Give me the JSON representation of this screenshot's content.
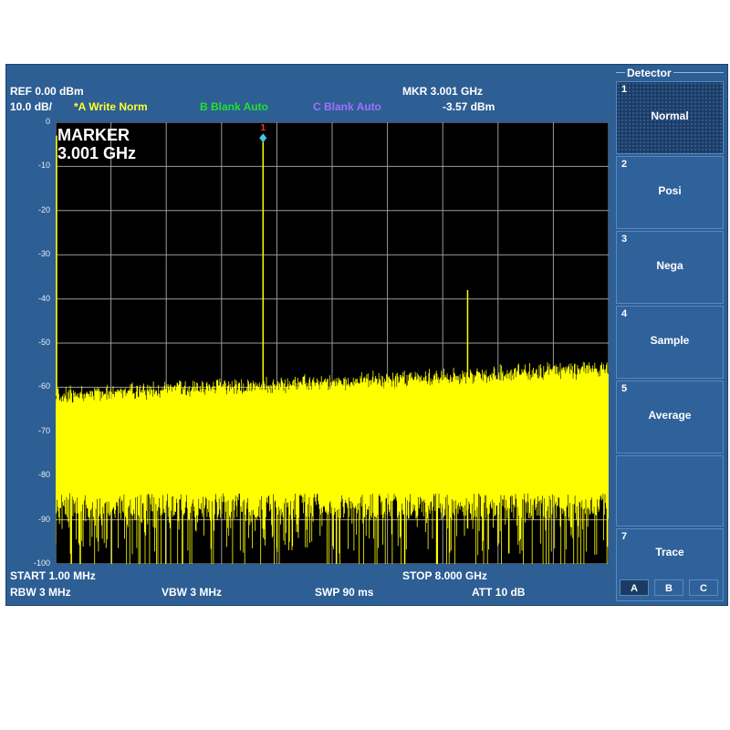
{
  "header": {
    "ref": "REF  0.00 dBm",
    "scale": "10.0 dB/",
    "trace_a": "*A Write Norm",
    "trace_b": "B Blank Auto",
    "trace_c": "C Blank Auto",
    "mkr_freq": "MKR  3.001  GHz",
    "mkr_level": "-3.57 dBm"
  },
  "marker": {
    "title": "MARKER",
    "freq": "3.001 GHz",
    "number": "1"
  },
  "y_labels": [
    "0",
    "-10",
    "-20",
    "-30",
    "-40",
    "-50",
    "-60",
    "-70",
    "-80",
    "-90",
    "-100"
  ],
  "footer": {
    "start": "START   1.00 MHz",
    "stop": "STOP 8.000 GHz",
    "rbw": "RBW  3 MHz",
    "vbw": "VBW  3 MHz",
    "swp": "SWP  90 ms",
    "att": "ATT  10 dB"
  },
  "detector": {
    "title": "Detector",
    "keys": [
      {
        "num": "1",
        "label": "Normal"
      },
      {
        "num": "2",
        "label": "Posi"
      },
      {
        "num": "3",
        "label": "Nega"
      },
      {
        "num": "4",
        "label": "Sample"
      },
      {
        "num": "5",
        "label": "Average"
      },
      {
        "num": "",
        "label": ""
      },
      {
        "num": "7",
        "label": "Trace"
      }
    ],
    "trace_buttons": [
      "A",
      "B",
      "C"
    ]
  },
  "spectrum": {
    "start_ghz": 0.001,
    "stop_ghz": 8.0,
    "ref_dbm": 0,
    "bottom_dbm": -100,
    "peaks": [
      {
        "freq_ghz": 3.001,
        "dbm": -3.57
      },
      {
        "freq_ghz": 5.96,
        "dbm": -38
      }
    ],
    "noise_top_dbm": [
      -62,
      -56
    ],
    "noise_bottom_dbm": -95
  },
  "colors": {
    "trace": "#ffff00",
    "panel": "#2d5e94",
    "trace_b": "#22e030",
    "trace_c": "#a070ff",
    "marker": "#ff3030",
    "marker_dot": "#40c8e8"
  }
}
